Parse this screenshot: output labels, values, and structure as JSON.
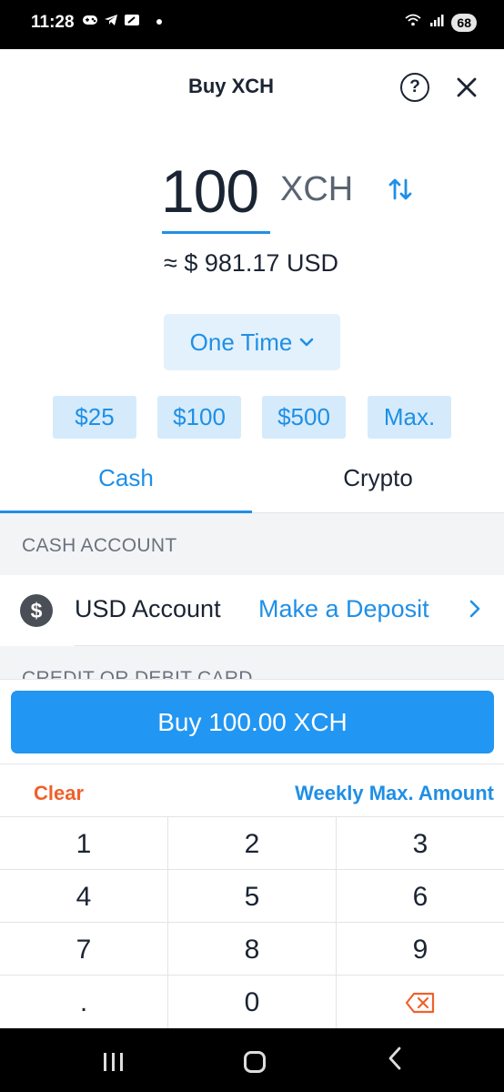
{
  "status_bar": {
    "time": "11:28",
    "battery": "68",
    "icons": [
      "gamepad-icon",
      "telegram-icon",
      "nfc-icon",
      "wifi-icon",
      "signal-icon"
    ]
  },
  "header": {
    "title": "Buy XCH",
    "help_label": "?",
    "close_label": "✕"
  },
  "amount": {
    "value": "100",
    "currency": "XCH",
    "usd_equivalent": "≈ $ 981.17 USD"
  },
  "frequency": {
    "selected": "One Time"
  },
  "presets": [
    "$25",
    "$100",
    "$500",
    "Max."
  ],
  "tabs": {
    "cash": "Cash",
    "crypto": "Crypto",
    "active": "cash"
  },
  "cash_account": {
    "section_title": "CASH ACCOUNT",
    "account_label": "USD Account",
    "deposit_link": "Make a Deposit"
  },
  "card_section": {
    "section_title": "CREDIT OR DEBIT CARD"
  },
  "buy_button": {
    "label": "Buy 100.00 XCH"
  },
  "keypad": {
    "clear": "Clear",
    "weekly_max": "Weekly Max. Amount",
    "keys": [
      "1",
      "2",
      "3",
      "4",
      "5",
      "6",
      "7",
      "8",
      "9",
      ".",
      "0"
    ]
  },
  "colors": {
    "accent": "#1f8fe6",
    "buy_button": "#2196f3",
    "clear": "#f0602a",
    "backspace": "#f0602a"
  }
}
